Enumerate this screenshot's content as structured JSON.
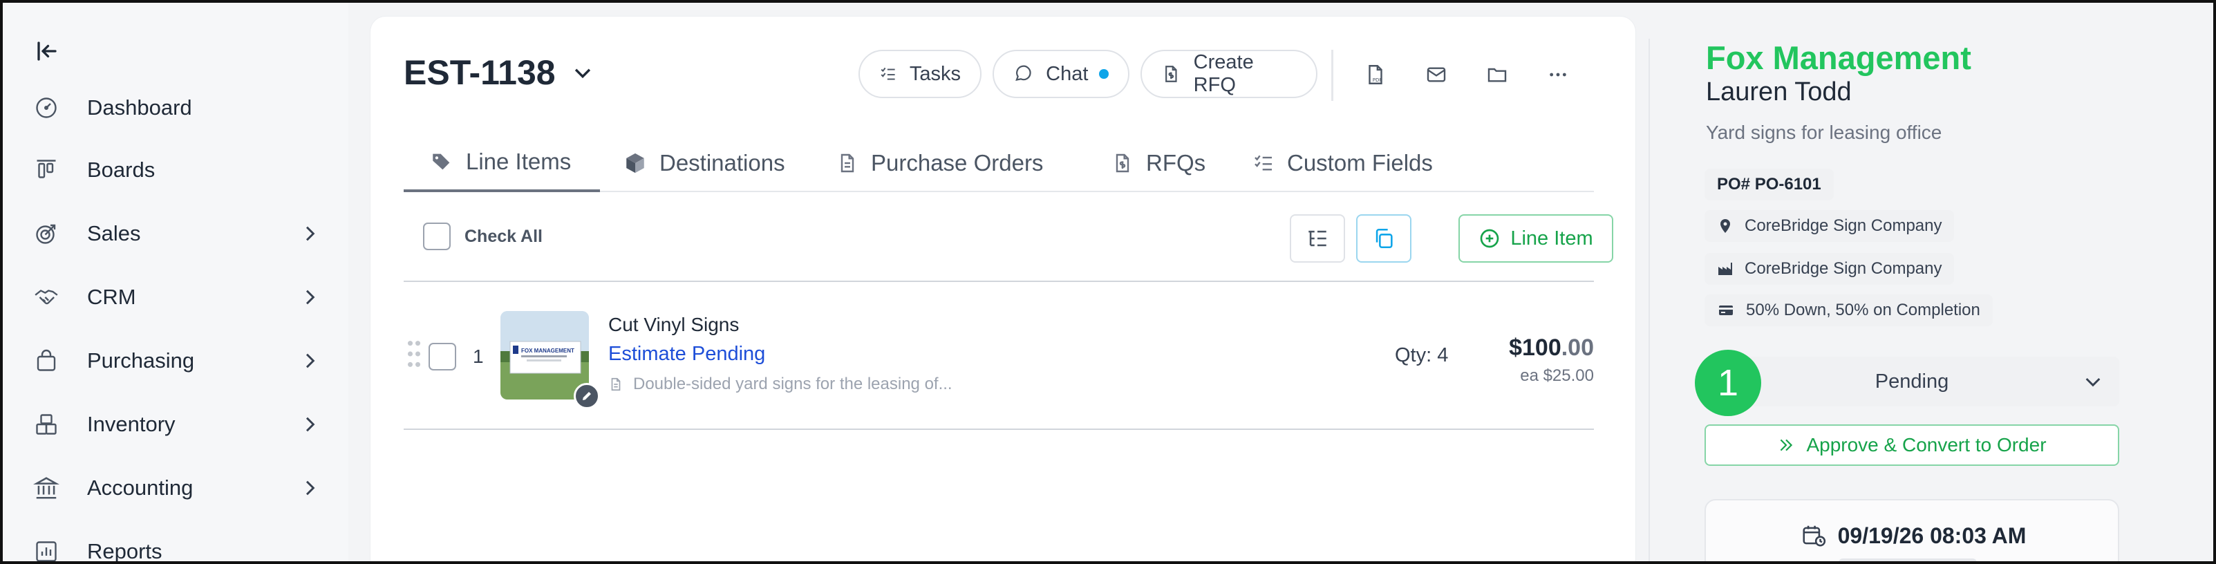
{
  "sidebar": {
    "items": [
      {
        "label": "Dashboard",
        "icon": "dashboard-gauge-icon",
        "has_submenu": false
      },
      {
        "label": "Boards",
        "icon": "boards-columns-icon",
        "has_submenu": false
      },
      {
        "label": "Sales",
        "icon": "sales-target-icon",
        "has_submenu": true
      },
      {
        "label": "CRM",
        "icon": "handshake-icon",
        "has_submenu": true
      },
      {
        "label": "Purchasing",
        "icon": "shopping-bag-icon",
        "has_submenu": true
      },
      {
        "label": "Inventory",
        "icon": "boxes-icon",
        "has_submenu": true
      },
      {
        "label": "Accounting",
        "icon": "bank-icon",
        "has_submenu": true
      },
      {
        "label": "Reports",
        "icon": "bar-chart-icon",
        "has_submenu": false
      }
    ]
  },
  "estimate": {
    "title": "EST-1138",
    "actions": {
      "tasks": "Tasks",
      "chat": "Chat",
      "create_rfq": "Create RFQ"
    },
    "tabs": [
      {
        "label": "Line Items",
        "active": true
      },
      {
        "label": "Destinations",
        "active": false
      },
      {
        "label": "Purchase Orders",
        "active": false
      },
      {
        "label": "RFQs",
        "active": false
      },
      {
        "label": "Custom Fields",
        "active": false
      }
    ],
    "check_all_label": "Check All",
    "add_line_item_label": "Line Item",
    "line_items": [
      {
        "number": "1",
        "name": "Cut Vinyl Signs",
        "status": "Estimate Pending",
        "description": "Double-sided yard signs for the leasing of...",
        "qty": "Qty: 4",
        "price_dollars": "$100",
        "price_cents": ".00",
        "each": "ea $25.00",
        "thumbnail_text": "FOX MANAGEMENT"
      }
    ]
  },
  "panel": {
    "company": "Fox Management",
    "contact": "Lauren Todd",
    "description": "Yard signs for leasing office",
    "po": "PO# PO-6101",
    "location": "CoreBridge Sign Company",
    "vendor": "CoreBridge Sign Company",
    "terms": "50% Down, 50% on Completion",
    "status": "Pending",
    "step_number": "1",
    "approve_label": "Approve & Convert to Order",
    "date": "09/19/26 08:03 AM"
  },
  "colors": {
    "accent_green": "#22c55e",
    "link_blue": "#1d4ed8",
    "chat_dot": "#0ea5e9"
  }
}
